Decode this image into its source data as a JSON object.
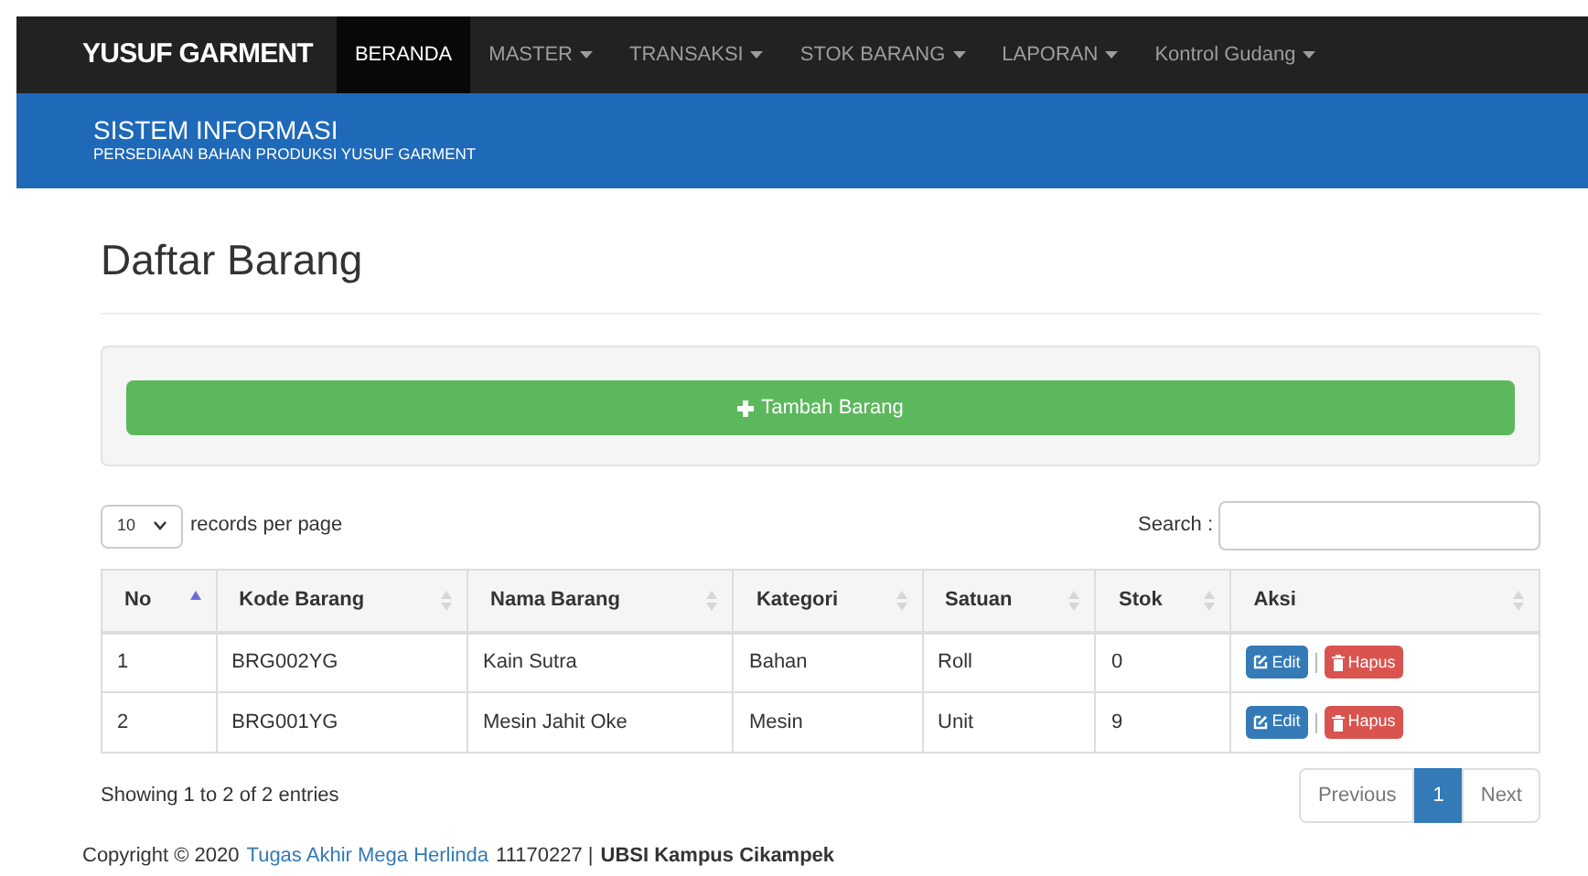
{
  "navbar": {
    "brand": "YUSUF GARMENT",
    "items": [
      {
        "label": "BERANDA",
        "selected": true,
        "dropdown": false
      },
      {
        "label": "MASTER",
        "selected": false,
        "dropdown": true
      },
      {
        "label": "TRANSAKSI",
        "selected": false,
        "dropdown": true
      },
      {
        "label": "STOK BARANG",
        "selected": false,
        "dropdown": true
      },
      {
        "label": "LAPORAN",
        "selected": false,
        "dropdown": true
      },
      {
        "label": "Kontrol Gudang",
        "selected": false,
        "dropdown": true
      }
    ]
  },
  "banner": {
    "title": "SISTEM INFORMASI",
    "subtitle": "PERSEDIAAN BAHAN PRODUKSI YUSUF GARMENT"
  },
  "page_title": "Daftar Barang",
  "add_button": "Tambah Barang",
  "length": {
    "value": "10",
    "label": "records per page"
  },
  "search": {
    "label": "Search :"
  },
  "table": {
    "columns": [
      {
        "label": "No",
        "sorted": true
      },
      {
        "label": "Kode Barang",
        "sorted": false
      },
      {
        "label": "Nama Barang",
        "sorted": false
      },
      {
        "label": "Kategori",
        "sorted": false
      },
      {
        "label": "Satuan",
        "sorted": false
      },
      {
        "label": "Stok",
        "sorted": false
      },
      {
        "label": "Aksi",
        "sorted": false
      }
    ],
    "rows": [
      {
        "cells": [
          "1",
          "BRG002YG",
          "Kain Sutra",
          "Bahan",
          "Roll",
          "0"
        ],
        "actions": [
          "Edit",
          "Hapus"
        ]
      },
      {
        "cells": [
          "2",
          "BRG001YG",
          "Mesin Jahit Oke",
          "Mesin",
          "Unit",
          "9"
        ],
        "actions": [
          "Edit",
          "Hapus"
        ]
      }
    ]
  },
  "info": "Showing 1 to 2 of 2 entries",
  "pagination": [
    {
      "label": "Previous",
      "selected": false
    },
    {
      "label": "1",
      "selected": true
    },
    {
      "label": "Next",
      "selected": false
    }
  ],
  "footer": {
    "prefix": "Copyright © 2020",
    "link": "Tugas Akhir Mega Herlinda",
    "number": "11170227 |",
    "campus": "UBSI Kampus Cikampek"
  }
}
